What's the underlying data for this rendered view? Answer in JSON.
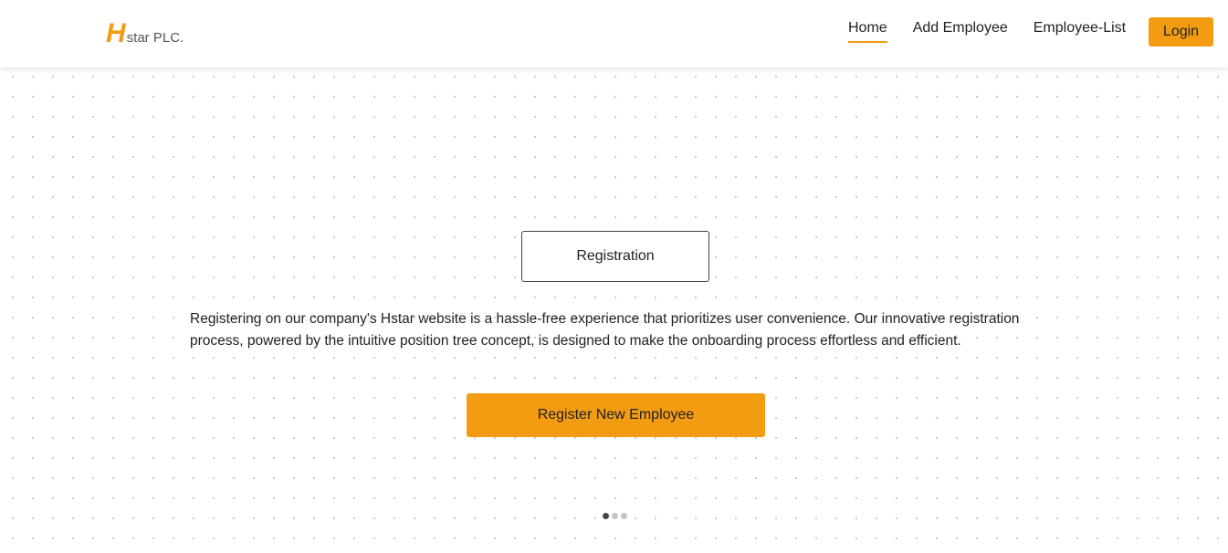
{
  "brand": {
    "letter": "H",
    "rest": "star PLC."
  },
  "nav": {
    "items": [
      {
        "label": "Home",
        "active": true
      },
      {
        "label": "Add Employee",
        "active": false
      },
      {
        "label": "Employee-List",
        "active": false
      }
    ],
    "login_label": "Login"
  },
  "hero": {
    "box_label": "Registration",
    "description": "Registering on our company's Hstar website is a hassle-free experience that prioritizes user convenience. Our innovative registration process, powered by the intuitive position tree concept, is designed to make the onboarding process effortless and efficient.",
    "cta_label": "Register New Employee"
  },
  "carousel": {
    "slide_count": 3,
    "active_index": 0
  },
  "colors": {
    "accent": "#f39c12",
    "text": "#222222",
    "dot_active": "#444444",
    "dot_inactive": "#c4c4c4"
  }
}
